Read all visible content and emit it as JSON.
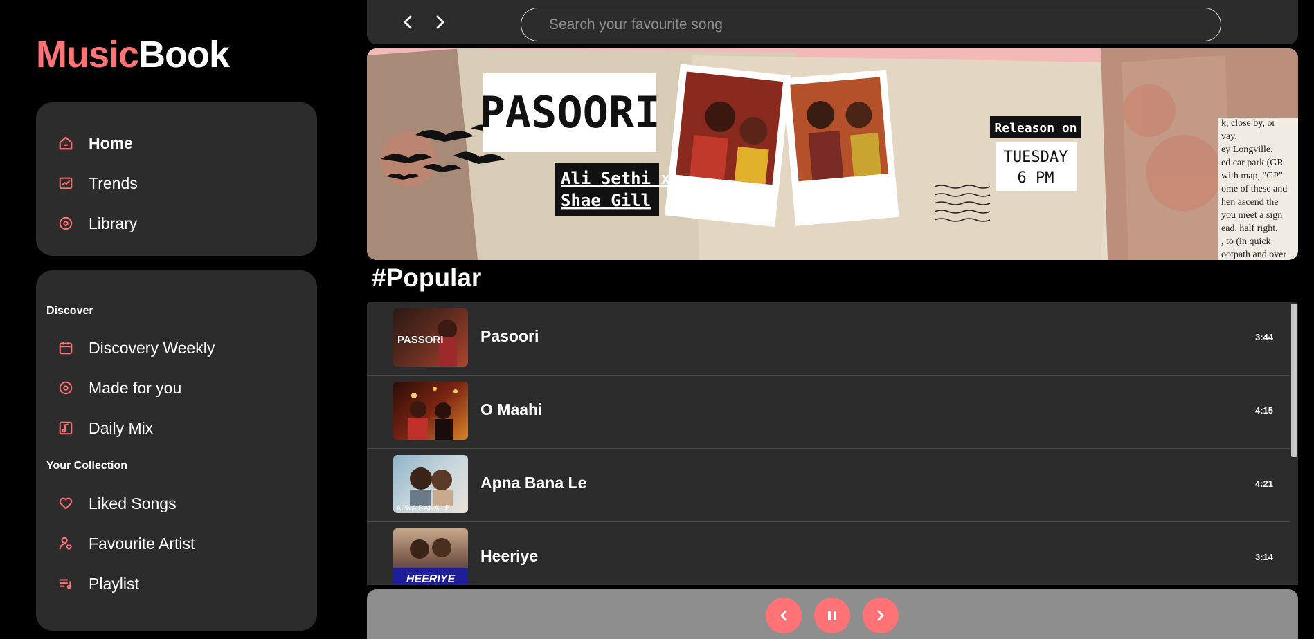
{
  "brand": {
    "part1": "Music",
    "part2": "Book",
    "accent": "#ff7276"
  },
  "nav": {
    "main": [
      {
        "label": "Home",
        "icon": "home-icon",
        "active": true
      },
      {
        "label": "Trends",
        "icon": "trend-chart-icon"
      },
      {
        "label": "Library",
        "icon": "disc-icon"
      }
    ],
    "discover_title": "Discover",
    "discover": [
      {
        "label": "Discovery Weekly",
        "icon": "calendar-icon"
      },
      {
        "label": "Made for you",
        "icon": "disc-icon"
      },
      {
        "label": "Daily Mix",
        "icon": "music-note-icon"
      }
    ],
    "collection_title": "Your Collection",
    "collection": [
      {
        "label": "Liked Songs",
        "icon": "heart-icon"
      },
      {
        "label": "Favourite Artist",
        "icon": "user-heart-icon"
      },
      {
        "label": "Playlist",
        "icon": "playlist-icon"
      }
    ]
  },
  "search": {
    "placeholder": "Search your favourite song"
  },
  "banner": {
    "title": "PASOORI",
    "artist_line1": "Ali Sethi x",
    "artist_line2": "Shae Gill",
    "release_label": "Releason on",
    "release_day": "TUESDAY",
    "release_time": "6 PM",
    "clipping_text": [
      "k, close by, or",
      "vay.",
      "ey Longville.",
      "ed car park (GR",
      "with map, \"GP\"",
      "ome of these and",
      "hen ascend the",
      "you meet a sign",
      "ead, half right,",
      ", to (in quick",
      "ootpath and over"
    ]
  },
  "popular": {
    "title": "#Popular",
    "songs": [
      {
        "title": "Pasoori",
        "duration": "3:44",
        "thumb_text": "PASSORI"
      },
      {
        "title": "O Maahi",
        "duration": "4:15",
        "thumb_text": ""
      },
      {
        "title": "Apna Bana Le",
        "duration": "4:21",
        "thumb_text": "APNA BANA LE"
      },
      {
        "title": "Heeriye",
        "duration": "3:14",
        "thumb_text": "HEERIYE"
      }
    ]
  },
  "player": {
    "prev_icon": "chevron-left-icon",
    "pause_icon": "pause-icon",
    "next_icon": "chevron-right-icon"
  }
}
